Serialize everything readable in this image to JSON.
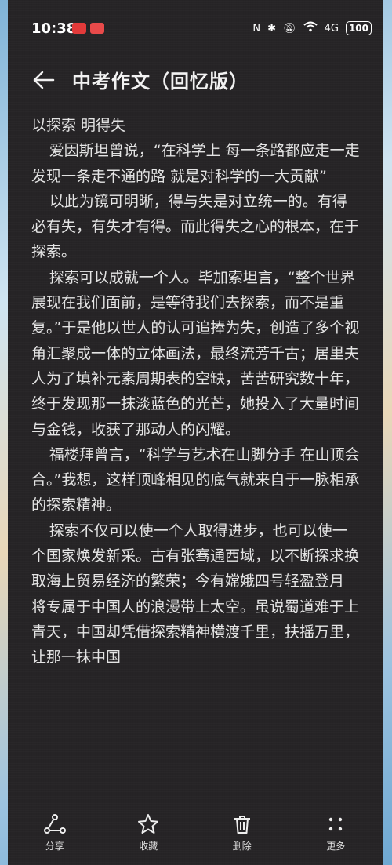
{
  "status": {
    "time": "10:38",
    "battery": "100",
    "network": "4G"
  },
  "header": {
    "title": "中考作文（回忆版）"
  },
  "article": {
    "paragraphs": [
      "以探索 明得失",
      "爱因斯坦曾说，“在科学上 每一条路都应走一走 发现一条走不通的路 就是对科学的一大贡献”",
      "以此为镜可明晰，得与失是对立统一的。有得必有失，有失才有得。而此得失之心的根本，在于探索。",
      "探索可以成就一个人。毕加索坦言，“整个世界展现在我们面前，是等待我们去探索，而不是重复。”于是他以世人的认可追捧为失，创造了多个视角汇聚成一体的立体画法，最终流芳千古；居里夫人为了填补元素周期表的空缺，苦苦研究数十年，终于发现那一抹淡蓝色的光芒，她投入了大量时间与金钱，收获了那动人的闪耀。",
      "福楼拜曾言，“科学与艺术在山脚分手 在山顶会合。”我想，这样顶峰相见的底气就来自于一脉相承的探索精神。",
      "探索不仅可以使一个人取得进步，也可以使一个国家焕发新采。古有张骞通西域，以不断探求换取海上贸易经济的繁荣；今有嫦娥四号轻盈登月 将专属于中国人的浪漫带上太空。虽说蜀道难于上青天，中国却凭借探索精神横渡千里，扶摇万里，让那一抹中国"
    ]
  },
  "toolbar": {
    "share": "分享",
    "favorite": "收藏",
    "delete": "删除",
    "more": "更多"
  }
}
